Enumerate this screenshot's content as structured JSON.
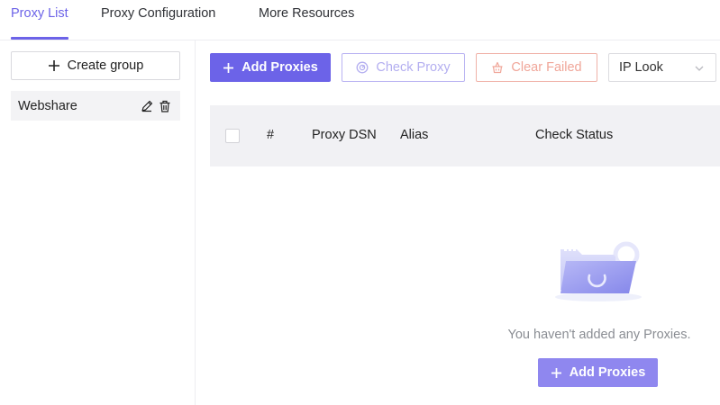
{
  "tabs": [
    {
      "label": "Proxy List",
      "active": true
    },
    {
      "label": "Proxy Configuration",
      "active": false
    },
    {
      "label": "More Resources",
      "active": false
    }
  ],
  "sidebar": {
    "create_group_label": "Create group",
    "groups": [
      {
        "name": "Webshare",
        "icons": [
          "edit-icon",
          "trash-icon"
        ]
      }
    ]
  },
  "toolbar": {
    "add_proxies_label": "Add Proxies",
    "check_proxy_label": "Check Proxy",
    "clear_failed_label": "Clear Failed",
    "ip_lookup_value": "IP Look"
  },
  "table": {
    "columns": [
      "#",
      "Proxy DSN",
      "Alias",
      "Check Status"
    ]
  },
  "empty_state": {
    "message": "You haven't added any Proxies.",
    "button_label": "Add Proxies"
  },
  "colors": {
    "accent": "#6c63e8",
    "accent_light": "#8f87ef",
    "danger_outline": "#f0b2a8",
    "header_bg": "#f1f1f4"
  }
}
